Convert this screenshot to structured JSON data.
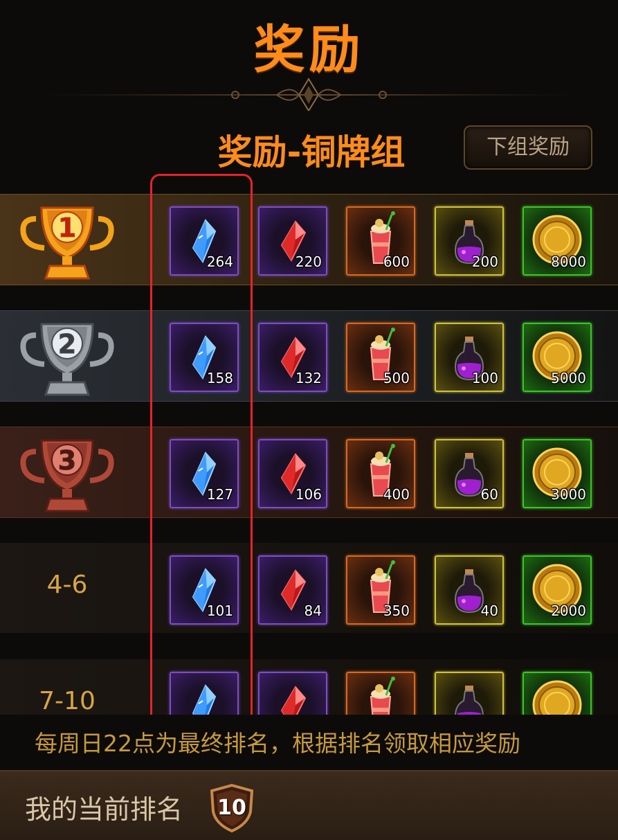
{
  "header": {
    "title": "奖励"
  },
  "group": {
    "title": "奖励-铜牌组",
    "next_button_label": "下组奖励"
  },
  "reward_types": [
    {
      "icon": "blue-crystal-icon",
      "rarity": "purple"
    },
    {
      "icon": "red-crystal-icon",
      "rarity": "purple"
    },
    {
      "icon": "cocktail-icon",
      "rarity": "orange"
    },
    {
      "icon": "purple-potion-icon",
      "rarity": "yellow"
    },
    {
      "icon": "gold-coin-icon",
      "rarity": "green"
    }
  ],
  "rows": [
    {
      "rank": "1",
      "trophy": "gold",
      "rewards": [
        "264",
        "220",
        "600",
        "200",
        "8000"
      ]
    },
    {
      "rank": "2",
      "trophy": "silver",
      "rewards": [
        "158",
        "132",
        "500",
        "100",
        "5000"
      ]
    },
    {
      "rank": "3",
      "trophy": "bronze",
      "rewards": [
        "127",
        "106",
        "400",
        "60",
        "3000"
      ]
    },
    {
      "rank": "4-6",
      "trophy": "",
      "rewards": [
        "101",
        "84",
        "350",
        "40",
        "2000"
      ]
    },
    {
      "rank": "7-10",
      "trophy": "",
      "rewards": [
        "",
        "",
        "",
        "",
        ""
      ]
    }
  ],
  "notice": "每周日22点为最终排名，根据排名领取相应奖励",
  "footer": {
    "label": "我的当前排名",
    "my_rank": "10"
  },
  "colors": {
    "accent": "#ff8c1a",
    "highlight": "#e8222a"
  }
}
